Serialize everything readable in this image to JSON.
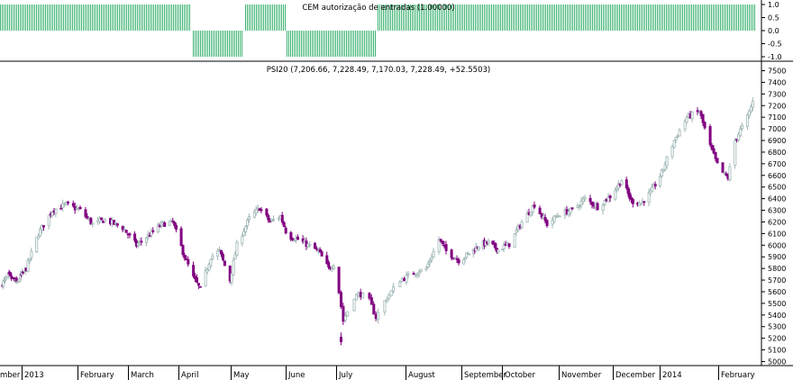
{
  "chart_data": [
    {
      "type": "bar",
      "title": "CEM autorização de entradas (1.00000)",
      "ylim": [
        -1,
        1
      ],
      "yticks": [
        "1.0",
        "0.5",
        "0.0",
        "-0.5",
        "-1.0"
      ],
      "colors": {
        "signal": "#3cb371"
      },
      "segments": [
        {
          "start": "2012-12-01",
          "end": "2013-04-07",
          "value": 1
        },
        {
          "start": "2013-04-08",
          "end": "2013-05-07",
          "value": -1
        },
        {
          "start": "2013-05-08",
          "end": "2013-05-31",
          "value": 1
        },
        {
          "start": "2013-06-01",
          "end": "2013-07-18",
          "value": -1
        },
        {
          "start": "2013-07-19",
          "end": "2014-02-28",
          "value": 1
        }
      ]
    },
    {
      "type": "candlestick",
      "title": "PSI20 (7,206.66, 7,228.49, 7,170.03, 7,228.49, +52.5503)",
      "ylim": [
        5000,
        7500
      ],
      "yticks": [
        "7500",
        "7400",
        "7300",
        "7200",
        "7100",
        "7000",
        "6900",
        "6800",
        "6700",
        "6600",
        "6500",
        "6400",
        "6300",
        "6200",
        "6100",
        "6000",
        "5900",
        "5800",
        "5700",
        "5600",
        "5500",
        "5400",
        "5300",
        "5200",
        "5100",
        "5000"
      ],
      "months": [
        "mber",
        "2013",
        "February",
        "March",
        "April",
        "May",
        "June",
        "July",
        "August",
        "September",
        "October",
        "November",
        "December",
        "2014",
        "February"
      ],
      "colors": {
        "up": "#9fb6b6",
        "down": "#800080",
        "grid": "#000000"
      },
      "close_path": [
        [
          "2012-12-01",
          5650
        ],
        [
          "2012-12-10",
          5740
        ],
        [
          "2012-12-20",
          5680
        ],
        [
          "2013-01-01",
          5800
        ],
        [
          "2013-01-08",
          6100
        ],
        [
          "2013-01-16",
          6300
        ],
        [
          "2013-01-24",
          6350
        ],
        [
          "2013-02-01",
          6300
        ],
        [
          "2013-02-08",
          6180
        ],
        [
          "2013-02-15",
          6220
        ],
        [
          "2013-02-25",
          6150
        ],
        [
          "2013-03-05",
          6000
        ],
        [
          "2013-03-12",
          6080
        ],
        [
          "2013-03-20",
          6180
        ],
        [
          "2013-03-27",
          6200
        ],
        [
          "2013-04-03",
          5900
        ],
        [
          "2013-04-08",
          5720
        ],
        [
          "2013-04-12",
          5620
        ],
        [
          "2013-04-18",
          5900
        ],
        [
          "2013-04-23",
          5950
        ],
        [
          "2013-04-29",
          5700
        ],
        [
          "2013-05-03",
          6000
        ],
        [
          "2013-05-10",
          6230
        ],
        [
          "2013-05-16",
          6320
        ],
        [
          "2013-05-22",
          6200
        ],
        [
          "2013-05-28",
          6250
        ],
        [
          "2013-06-01",
          6080
        ],
        [
          "2013-06-07",
          6050
        ],
        [
          "2013-06-13",
          6000
        ],
        [
          "2013-06-19",
          5950
        ],
        [
          "2013-06-25",
          5800
        ],
        [
          "2013-06-29",
          5850
        ],
        [
          "2013-07-03",
          5350
        ],
        [
          "2013-07-08",
          5560
        ],
        [
          "2013-07-11",
          5580
        ],
        [
          "2013-07-15",
          5520
        ],
        [
          "2013-07-18",
          5380
        ],
        [
          "2013-07-23",
          5550
        ],
        [
          "2013-07-29",
          5700
        ],
        [
          "2013-08-05",
          5760
        ],
        [
          "2013-08-12",
          5800
        ],
        [
          "2013-08-19",
          6050
        ],
        [
          "2013-08-23",
          5950
        ],
        [
          "2013-08-30",
          5870
        ],
        [
          "2013-09-06",
          5930
        ],
        [
          "2013-09-13",
          6000
        ],
        [
          "2013-09-20",
          6020
        ],
        [
          "2013-09-27",
          5960
        ],
        [
          "2013-10-04",
          6010
        ],
        [
          "2013-10-11",
          6200
        ],
        [
          "2013-10-18",
          6350
        ],
        [
          "2013-10-25",
          6180
        ],
        [
          "2013-11-01",
          6270
        ],
        [
          "2013-11-08",
          6300
        ],
        [
          "2013-11-15",
          6400
        ],
        [
          "2013-11-22",
          6330
        ],
        [
          "2013-11-29",
          6420
        ],
        [
          "2013-12-06",
          6560
        ],
        [
          "2013-12-12",
          6380
        ],
        [
          "2013-12-18",
          6360
        ],
        [
          "2013-12-24",
          6450
        ],
        [
          "2013-12-31",
          6620
        ],
        [
          "2014-01-07",
          6900
        ],
        [
          "2014-01-14",
          7100
        ],
        [
          "2014-01-21",
          7150
        ],
        [
          "2014-01-27",
          6850
        ],
        [
          "2014-02-01",
          6650
        ],
        [
          "2014-02-06",
          6580
        ],
        [
          "2014-02-10",
          6900
        ],
        [
          "2014-02-17",
          7100
        ],
        [
          "2014-02-21",
          7280
        ],
        [
          "2014-02-26",
          7228
        ]
      ],
      "anomalies": [
        [
          "2013-07-02",
          5210,
          5170
        ]
      ]
    }
  ]
}
